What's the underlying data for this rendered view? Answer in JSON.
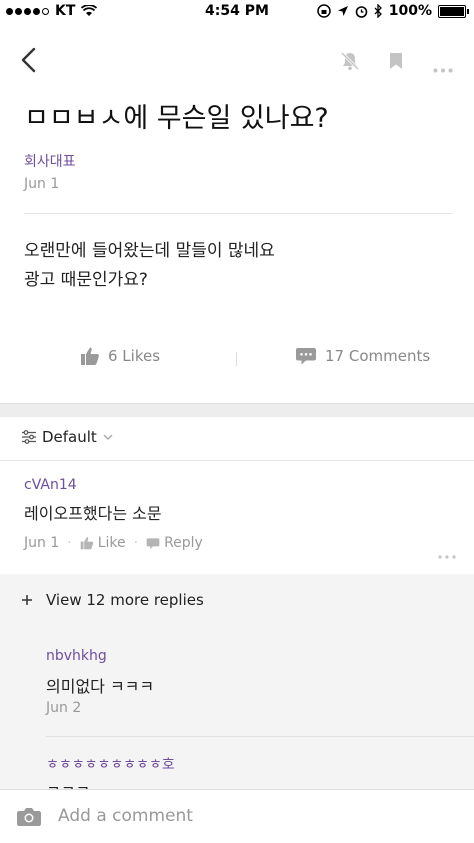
{
  "status": {
    "carrier": "KT",
    "time": "4:54 PM",
    "battery": "100%"
  },
  "post": {
    "title": "ㅁㅁㅂㅅ에 무슨일 있나요?",
    "author": "회사대표",
    "date": "Jun 1",
    "body_lines": [
      "오랜만에 들어왔는데 말들이 많네요",
      "광고 때문인가요?"
    ],
    "likes": "6 Likes",
    "comments": "17 Comments"
  },
  "sort": {
    "label": "Default"
  },
  "comment": {
    "author": "cVAn14",
    "text": "레이오프했다는 소문",
    "date": "Jun 1",
    "like_label": "Like",
    "reply_label": "Reply"
  },
  "replies": {
    "view_more": "View 12 more replies",
    "items": [
      {
        "author": "nbvhkhg",
        "text": "의미없다 ㅋㅋㅋ",
        "date": "Jun 2"
      },
      {
        "author": "ㅎㅎㅎㅎㅎㅎㅎㅎㅎ호",
        "text": "ㅋㅋㅋ"
      }
    ]
  },
  "composer": {
    "placeholder": "Add a comment"
  },
  "colors": {
    "accent": "#6f4e9e"
  }
}
